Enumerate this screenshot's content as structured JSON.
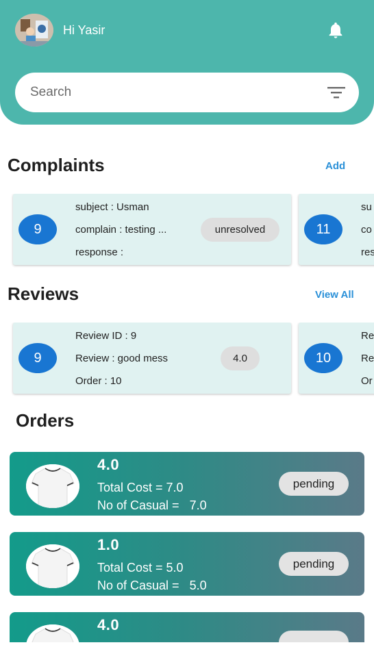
{
  "header": {
    "greeting": "Hi Yasir",
    "avatar_icon": "user-avatar-photo",
    "notification_icon": "bell-icon",
    "bg_color": "#4db6ac"
  },
  "search": {
    "placeholder": "Search",
    "filter_icon": "filter-icon"
  },
  "complaints": {
    "title": "Complaints",
    "action_label": "Add",
    "items": [
      {
        "id": "9",
        "subject": "subject : Usman",
        "complain": "complain : testing ...",
        "response": "response :",
        "status": "unresolved"
      },
      {
        "id": "11",
        "subject": "su",
        "complain": "co",
        "response": "res"
      }
    ]
  },
  "reviews": {
    "title": "Reviews",
    "action_label": "View All",
    "items": [
      {
        "id": "9",
        "review_id": "Review ID : 9",
        "review": "Review : good mess",
        "order": "Order : 10",
        "rating": "4.0"
      },
      {
        "id": "10",
        "review_id": "Re",
        "review": "Re",
        "order": "Or"
      }
    ]
  },
  "orders": {
    "title": "Orders",
    "items": [
      {
        "title": "4.0",
        "total_cost": "Total Cost = 7.0",
        "casual": "No of Casual =   7.0",
        "status": "pending"
      },
      {
        "title": "1.0",
        "total_cost": "Total Cost = 5.0",
        "casual": "No of Casual =   5.0",
        "status": "pending"
      },
      {
        "title": "4.0"
      }
    ]
  },
  "colors": {
    "accent": "#4db6ac",
    "circle": "#1976d2",
    "link": "#2a90d8",
    "card_bg": "#e0f2f1"
  }
}
